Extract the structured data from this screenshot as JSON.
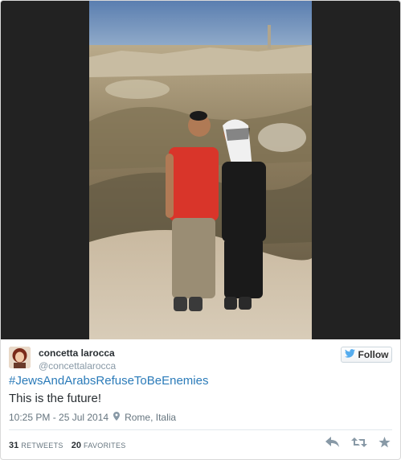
{
  "tweet": {
    "author": {
      "name": "concetta larocca",
      "handle": "@concettalarocca"
    },
    "follow_label": "Follow",
    "hashtag": "#JewsAndArabsRefuseToBeEnemies",
    "text": "This is the future!",
    "timestamp": "10:25 PM - 25 Jul 2014",
    "location": "Rome, Italia",
    "stats": {
      "retweets_count": "31",
      "retweets_label": "RETWEETS",
      "favorites_count": "20",
      "favorites_label": "FAVORITES"
    },
    "colors": {
      "link": "#2b7bb9",
      "text": "#292f33",
      "muted": "#66757f",
      "icon": "#8899a6",
      "follow_bird": "#55acee"
    },
    "icons": [
      "twitter-bird-icon",
      "location-pin-icon",
      "reply-icon",
      "retweet-icon",
      "favorite-star-icon"
    ]
  }
}
